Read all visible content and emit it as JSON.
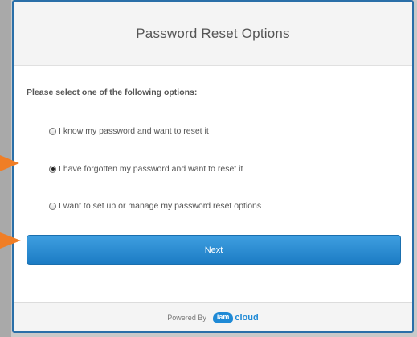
{
  "dialog": {
    "title": "Password Reset Options",
    "prompt": "Please select one of the following options:",
    "options": [
      {
        "label": "I know my password and want to reset it",
        "selected": false
      },
      {
        "label": "I have forgotten my password and want to reset it",
        "selected": true
      },
      {
        "label": "I want to set up or manage my password reset options",
        "selected": false
      }
    ],
    "next_label": "Next"
  },
  "footer": {
    "powered_by": "Powered By",
    "logo_part1": "iam",
    "logo_part2": "cloud"
  },
  "colors": {
    "accent": "#1f8ad6",
    "arrow": "#f07e26",
    "border": "#2a6fa8"
  }
}
